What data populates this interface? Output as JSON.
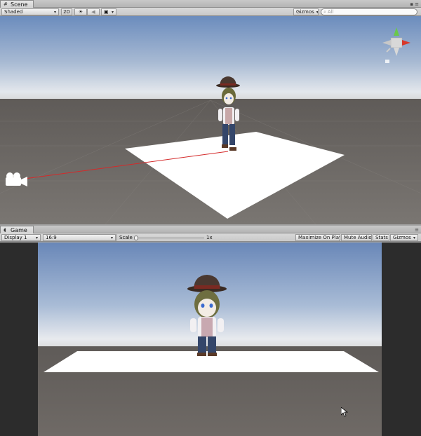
{
  "scene": {
    "tab_label": "Scene",
    "shading_mode": "Shaded",
    "mode_2d_label": "2D",
    "gizmos_label": "Gizmos",
    "search_placeholder": "All"
  },
  "game": {
    "tab_label": "Game",
    "display_label": "Display 1",
    "aspect_label": "16:9",
    "scale_label": "Scale",
    "scale_value": "1x",
    "scale_slider_level": 0.0,
    "maximize_label": "Maximize On Play",
    "mute_label": "Mute Audio",
    "stats_label": "Stats",
    "gizmos_label": "Gizmos"
  },
  "icons": {
    "scene_tab": "scene-grid-icon",
    "game_tab": "game-pacman-icon",
    "lighting": "sun-icon",
    "audio": "speaker-icon",
    "effects": "image-icon",
    "camera": "camera-icon",
    "gizmo": "axis-gizmo-icon",
    "cursor": "mouse-cursor-icon"
  },
  "colors": {
    "sky_top": "#6e8fbf",
    "horizon": "#e4e8ee",
    "ground": "#6e6a66",
    "plane": "#ffffff",
    "camera_line": "#d42a2a"
  }
}
